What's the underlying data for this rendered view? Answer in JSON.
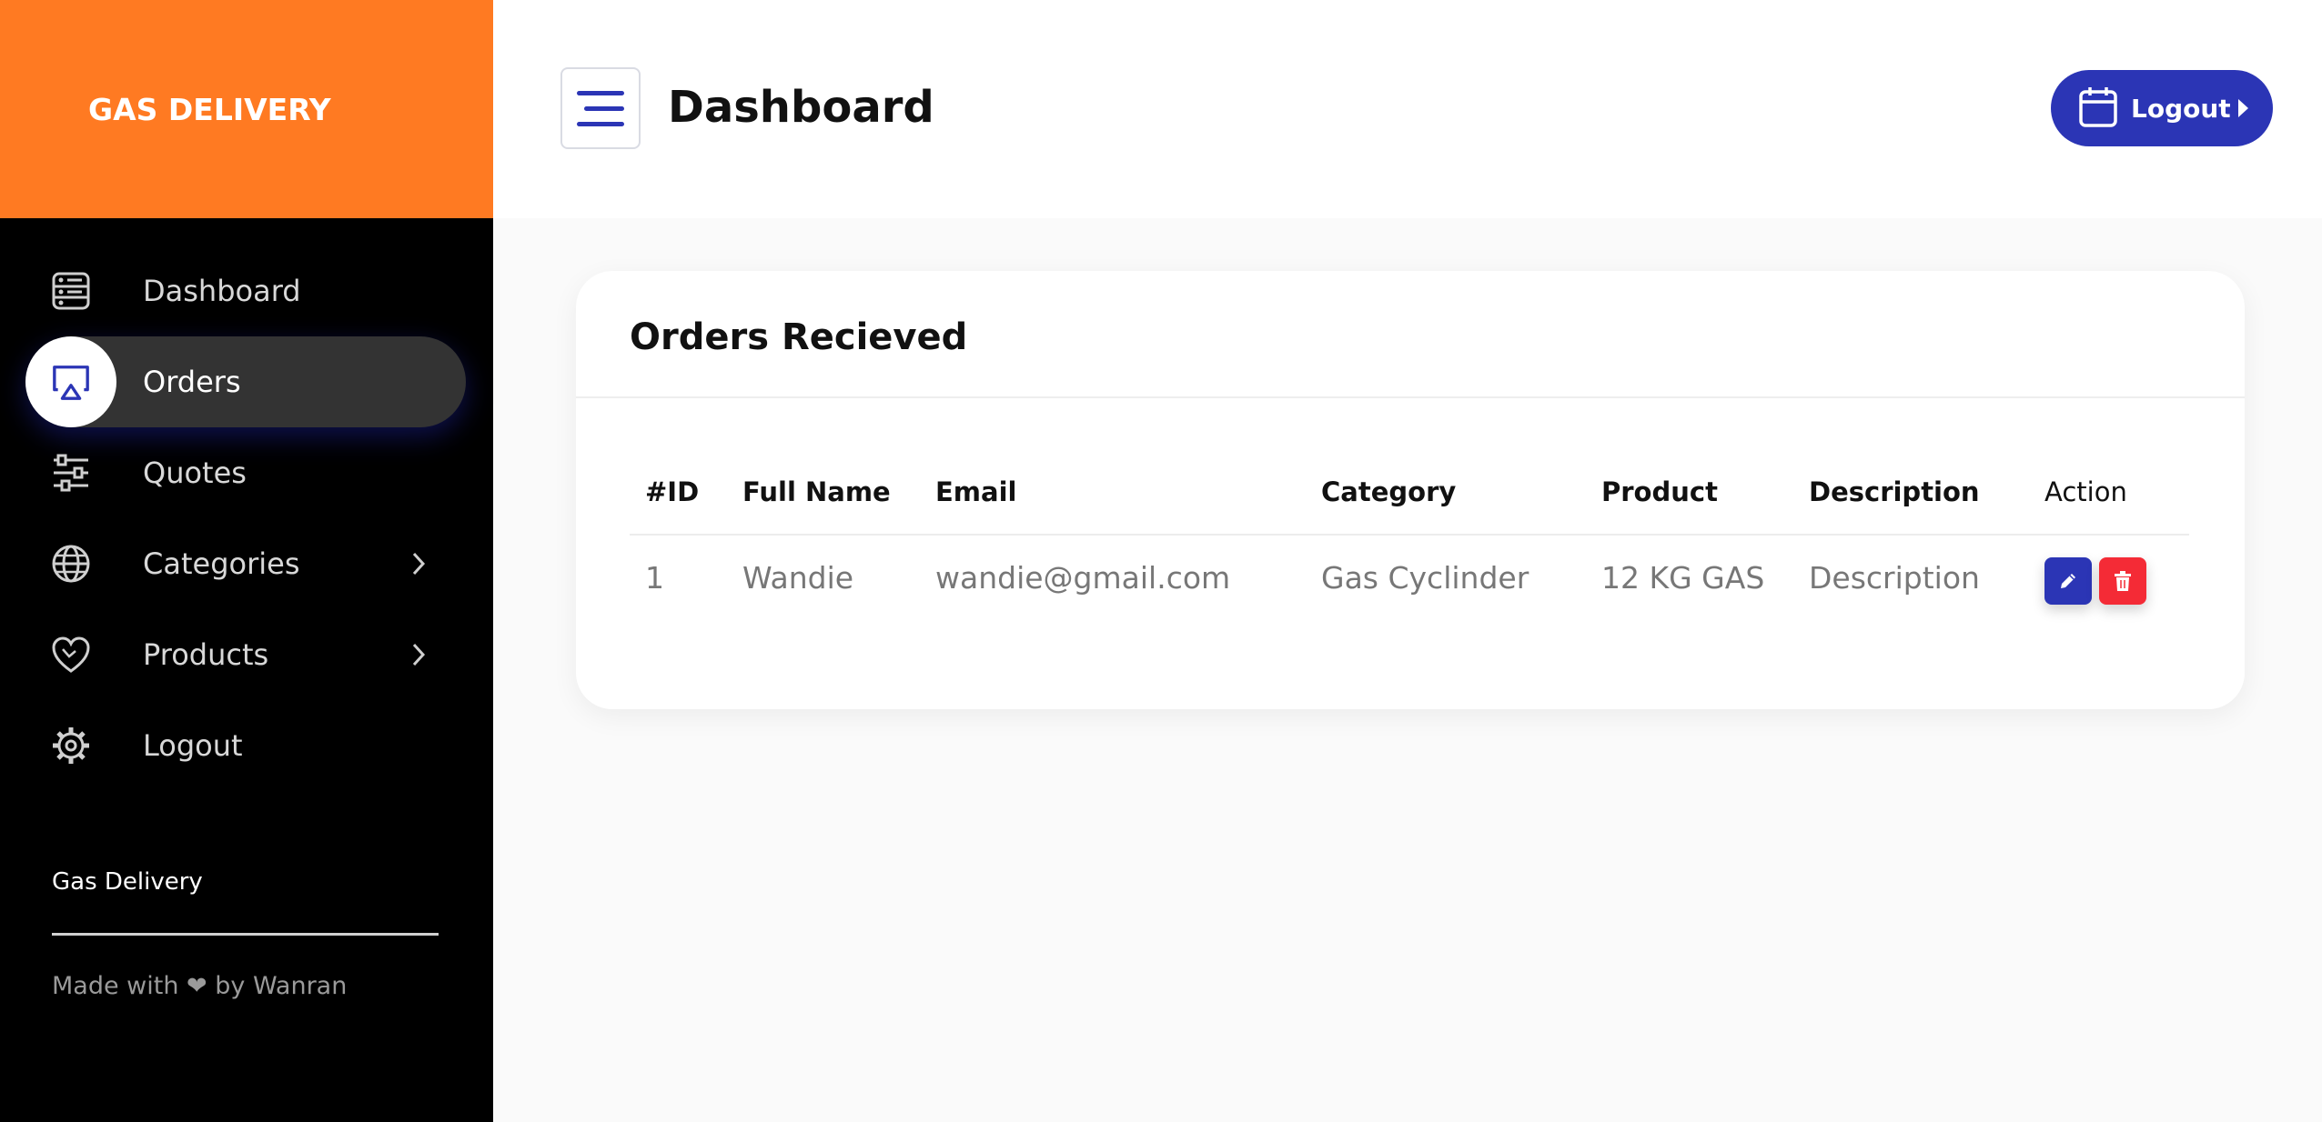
{
  "sidebar": {
    "brand": "GAS DELIVERY",
    "items": [
      {
        "label": "Dashboard",
        "icon": "dashboard-icon",
        "active": false
      },
      {
        "label": "Orders",
        "icon": "airplay-icon",
        "active": true
      },
      {
        "label": "Quotes",
        "icon": "sliders-icon",
        "active": false
      },
      {
        "label": "Categories",
        "icon": "globe-icon",
        "active": false,
        "has_submenu": true
      },
      {
        "label": "Products",
        "icon": "heart-icon",
        "active": false,
        "has_submenu": true
      },
      {
        "label": "Logout",
        "icon": "gear-icon",
        "active": false
      }
    ],
    "footer_title": "Gas Delivery",
    "made_with": "Made with ❤ by Wanran"
  },
  "header": {
    "title": "Dashboard",
    "logout_label": "Logout"
  },
  "orders": {
    "title": "Orders Recieved",
    "columns": [
      "#ID",
      "Full Name",
      "Email",
      "Category",
      "Product",
      "Description",
      "Action"
    ],
    "rows": [
      {
        "id": "1",
        "name": "Wandie",
        "email": "wandie@gmail.com",
        "category": "Gas Cyclinder",
        "product": "12 KG GAS",
        "description": "Description"
      }
    ]
  },
  "colors": {
    "brand_orange": "#ff7a22",
    "primary_blue": "#2b35b5",
    "danger_red": "#f42b36",
    "sidebar_bg": "#000000"
  }
}
